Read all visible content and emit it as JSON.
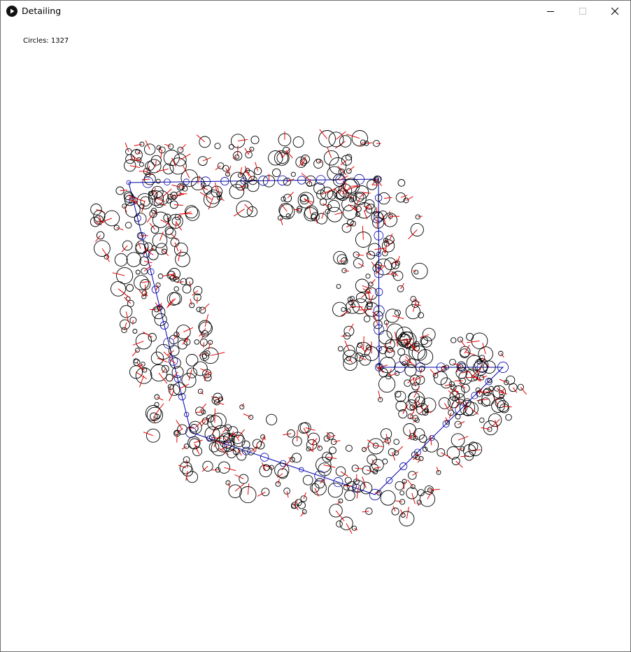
{
  "window": {
    "title": "Detailing",
    "minimize_icon": "minimize-icon",
    "maximize_icon": "maximize-icon",
    "close_icon": "close-icon",
    "app_icon": "play-icon"
  },
  "canvas": {
    "counter_label": "Circles: 1327",
    "background": "#ffffff",
    "circle_color": "#000000",
    "link_color": "#e00000",
    "path_color": "#0000aa"
  }
}
